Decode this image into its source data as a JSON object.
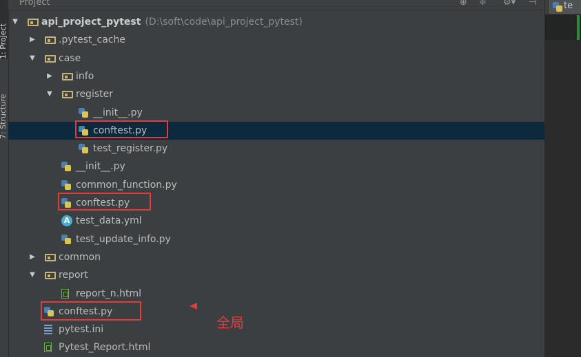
{
  "window": {
    "panel_title": "Project",
    "side_tabs": [
      "1: Project",
      "7: Structure"
    ],
    "header_icons": [
      "settings-target-icon",
      "collapse-icon",
      "gear-icon",
      "hide-icon"
    ]
  },
  "editor": {
    "tab_label": "te"
  },
  "tree": [
    {
      "id": "root",
      "label": "api_project_pytest",
      "path": "(D:\\soft\\code\\api_project_pytest)",
      "type": "folder",
      "expanded": true,
      "depth": 0,
      "bold": true
    },
    {
      "id": "pytest_cache",
      "label": ".pytest_cache",
      "type": "folder",
      "expanded": false,
      "depth": 1
    },
    {
      "id": "case",
      "label": "case",
      "type": "folder",
      "expanded": true,
      "depth": 1
    },
    {
      "id": "info",
      "label": "info",
      "type": "folder",
      "expanded": false,
      "depth": 2
    },
    {
      "id": "register",
      "label": "register",
      "type": "folder",
      "expanded": true,
      "depth": 2
    },
    {
      "id": "register_init",
      "label": "__init__.py",
      "type": "python",
      "depth": 3
    },
    {
      "id": "register_conftest",
      "label": "conftest.py",
      "type": "python",
      "depth": 3,
      "selected": true,
      "highlighted": true
    },
    {
      "id": "test_register",
      "label": "test_register.py",
      "type": "python",
      "depth": 3
    },
    {
      "id": "case_init",
      "label": "__init__.py",
      "type": "python",
      "depth": 2
    },
    {
      "id": "common_function",
      "label": "common_function.py",
      "type": "python",
      "depth": 2
    },
    {
      "id": "case_conftest",
      "label": "conftest.py",
      "type": "python",
      "depth": 2,
      "highlighted": true
    },
    {
      "id": "test_data",
      "label": "test_data.yml",
      "type": "yml",
      "depth": 2
    },
    {
      "id": "test_update_info",
      "label": "test_update_info.py",
      "type": "python",
      "depth": 2
    },
    {
      "id": "common",
      "label": "common",
      "type": "folder",
      "expanded": false,
      "depth": 1
    },
    {
      "id": "report",
      "label": "report",
      "type": "folder",
      "expanded": true,
      "depth": 1
    },
    {
      "id": "report_n",
      "label": "report_n.html",
      "type": "html",
      "depth": 2
    },
    {
      "id": "root_conftest",
      "label": "conftest.py",
      "type": "python",
      "depth": 1,
      "highlighted": true
    },
    {
      "id": "pytest_ini",
      "label": "pytest.ini",
      "type": "ini",
      "depth": 1
    },
    {
      "id": "pytest_report",
      "label": "Pytest_Report.html",
      "type": "html",
      "depth": 1
    }
  ],
  "annotation": {
    "text": "全局",
    "color": "#e03c3c"
  },
  "colors": {
    "background": "#3c3f41",
    "selection": "#0d293e",
    "highlight_box": "#e03c3c",
    "text": "#bbbbbb"
  }
}
